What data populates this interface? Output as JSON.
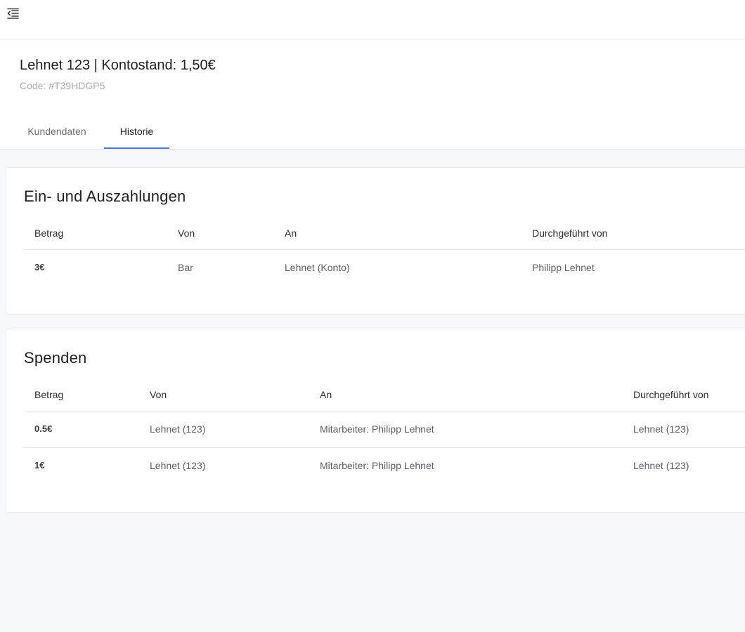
{
  "header": {
    "title": "Lehnet 123 | Kontostand: 1,50€",
    "code": "Code: #T39HDGP5"
  },
  "tabs": [
    {
      "label": "Kundendaten",
      "active": false
    },
    {
      "label": "Historie",
      "active": true
    }
  ],
  "payments": {
    "title": "Ein- und Auszahlungen",
    "columns": [
      "Betrag",
      "Von",
      "An",
      "Durchgeführt von"
    ],
    "rows": [
      [
        "3€",
        "Bar",
        "Lehnet (Konto)",
        "Philipp Lehnet"
      ]
    ]
  },
  "donations": {
    "title": "Spenden",
    "columns": [
      "Betrag",
      "Von",
      "An",
      "Durchgeführt von"
    ],
    "rows": [
      [
        "0.5€",
        "Lehnet (123)",
        "Mitarbeiter: Philipp Lehnet",
        "Lehnet (123)"
      ],
      [
        "1€",
        "Lehnet (123)",
        "Mitarbeiter: Philipp Lehnet",
        "Lehnet (123)"
      ]
    ]
  },
  "colors": {
    "accent": "#3b7ddd",
    "background": "#f7f8fc"
  },
  "icons": {
    "menu_toggle": "menu-collapse-icon"
  }
}
